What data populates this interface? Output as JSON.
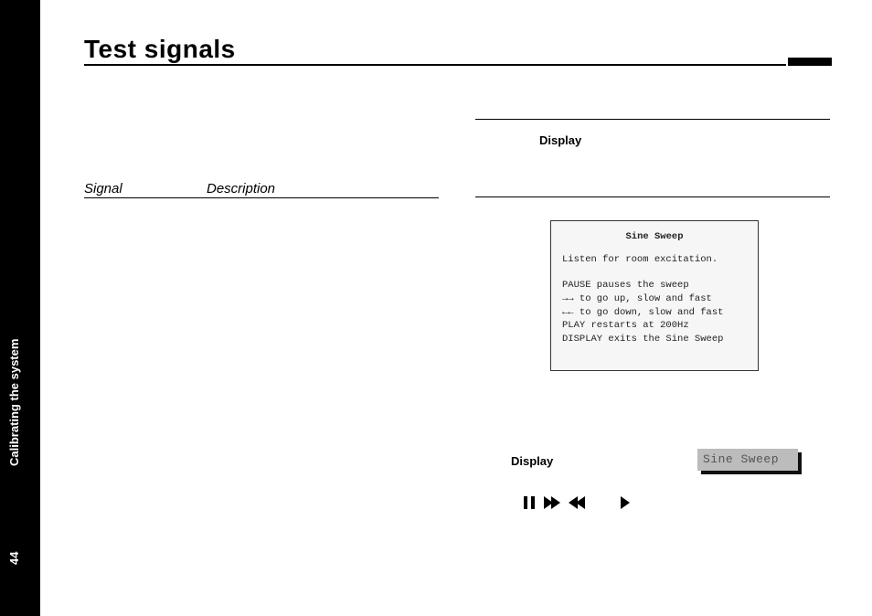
{
  "sidebar": {
    "section_label": "Calibrating the system",
    "page_number": "44"
  },
  "title": "Test signals",
  "left_table": {
    "col1": "Signal",
    "col2": "Description"
  },
  "right": {
    "display_label_top": "Display",
    "lcd": {
      "title": "Sine Sweep",
      "listen": "Listen for room excitation.",
      "l1": "PAUSE pauses the sweep",
      "l2": "→→ to go up, slow and fast",
      "l3": "←← to go down, slow and fast",
      "l4": "PLAY restarts at 200Hz",
      "l5": "DISPLAY exits the Sine Sweep"
    },
    "display_label_bottom": "Display",
    "chip_text": "Sine Sweep"
  }
}
